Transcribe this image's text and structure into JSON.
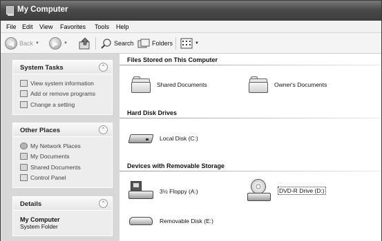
{
  "window": {
    "title": "My Computer"
  },
  "menu": [
    "File",
    "Edit",
    "View",
    "Favorites",
    "Tools",
    "Help"
  ],
  "toolbar": {
    "back_label": "Back",
    "search_label": "Search",
    "folders_label": "Folders"
  },
  "sidebar": {
    "system_tasks": {
      "title": "System Tasks",
      "items": [
        "View system information",
        "Add or remove programs",
        "Change a setting"
      ]
    },
    "other_places": {
      "title": "Other Places",
      "items": [
        "My Network Places",
        "My Documents",
        "Shared Documents",
        "Control Panel"
      ]
    },
    "details": {
      "title": "Details",
      "name": "My Computer",
      "type": "System Folder"
    }
  },
  "main": {
    "groups": [
      {
        "title": "Files Stored on This Computer",
        "items": [
          "Shared Documents",
          "Owner's Documents"
        ]
      },
      {
        "title": "Hard Disk Drives",
        "items": [
          "Local Disk (C:)"
        ]
      },
      {
        "title": "Devices with Removable Storage",
        "items": [
          "3½ Floppy (A:)",
          "DVD-R Drive (D:)",
          "Removable Disk (E:)"
        ]
      }
    ]
  },
  "icons": {
    "app": "computer-icon",
    "folder": "folder-icon",
    "hard_disk": "hard-disk-icon",
    "floppy": "floppy-drive-icon",
    "dvd": "dvd-drive-icon",
    "removable": "removable-disk-icon"
  }
}
